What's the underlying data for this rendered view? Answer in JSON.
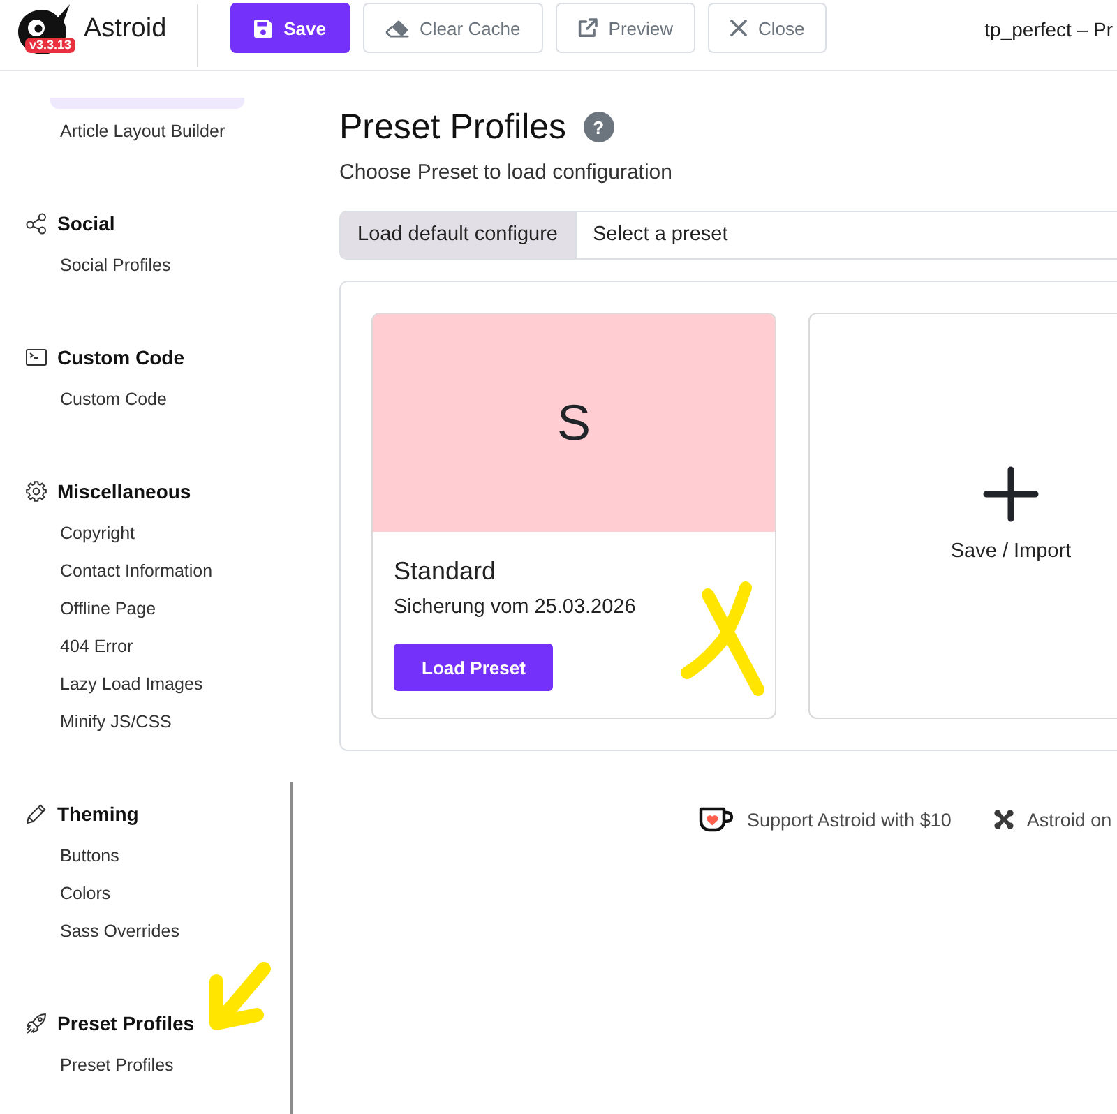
{
  "header": {
    "logo_badge": "v3.3.13",
    "app_name": "Astroid",
    "buttons": [
      {
        "label": "Save",
        "kind": "primary"
      },
      {
        "label": "Clear Cache",
        "kind": "outline"
      },
      {
        "label": "Preview",
        "kind": "outline"
      },
      {
        "label": "Close",
        "kind": "outline"
      }
    ],
    "document_title": "tp_perfect – Pr"
  },
  "sidebar": {
    "groups": [
      {
        "items": [
          {
            "selected": true
          },
          {
            "label": "Article Layout Builder",
            "selected": false
          }
        ]
      },
      {
        "title": "Social",
        "items": [
          {
            "label": "Social Profiles",
            "selected": false
          }
        ]
      },
      {
        "title": "Custom Code",
        "items": [
          {
            "label": "Custom Code",
            "selected": false
          }
        ]
      },
      {
        "title": "Miscellaneous",
        "items": [
          {
            "label": "Copyright",
            "selected": false
          },
          {
            "label": "Contact Information",
            "selected": false
          },
          {
            "label": "Offline Page",
            "selected": false
          },
          {
            "label": "404 Error",
            "selected": false
          },
          {
            "label": "Lazy Load Images",
            "selected": false
          },
          {
            "label": "Minify JS/CSS",
            "selected": false
          }
        ]
      },
      {
        "title": "Theming",
        "items": [
          {
            "label": "Buttons",
            "selected": false
          },
          {
            "label": "Colors",
            "selected": false
          },
          {
            "label": "Sass Overrides",
            "selected": false
          }
        ]
      },
      {
        "title": "Preset Profiles",
        "items": [
          {
            "label": "Preset Profiles",
            "selected": false
          }
        ]
      }
    ]
  },
  "main": {
    "title": "Preset Profiles",
    "help": "?",
    "subtitle": "Choose Preset to load configuration",
    "preset_picker": {
      "addon": "Load default configure",
      "value": "Select a preset"
    },
    "presets": [
      {
        "initial": "S",
        "color": "#ffcdd2",
        "name": "Standard",
        "description": "Sicherung vom 25.03.2026",
        "button": "Load Preset"
      }
    ],
    "add_card": {
      "label": "Save / Import"
    }
  },
  "footer": {
    "links": [
      {
        "label": "Support Astroid with $10"
      },
      {
        "label": "Astroid on"
      }
    ]
  },
  "annotations": [
    {
      "kind": "cross"
    },
    {
      "kind": "arrow"
    }
  ]
}
